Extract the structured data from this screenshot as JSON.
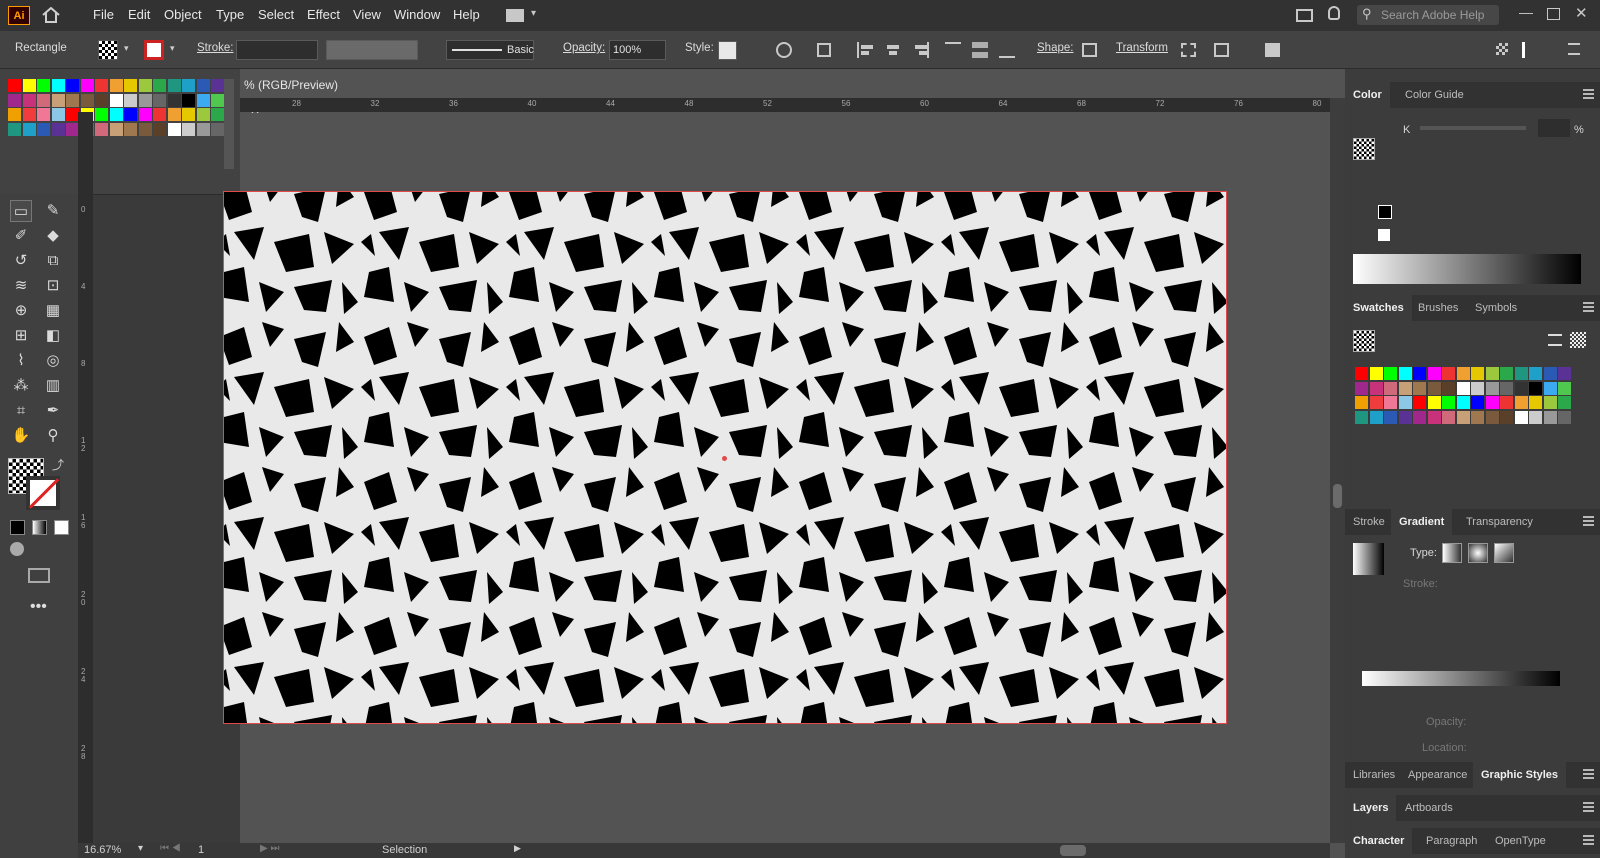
{
  "app": {
    "logo": "Ai",
    "menu": [
      "File",
      "Edit",
      "Object",
      "Type",
      "Select",
      "Effect",
      "View",
      "Window",
      "Help"
    ],
    "search_placeholder": "Search Adobe Help"
  },
  "control": {
    "tool_name": "Rectangle",
    "stroke_label": "Stroke:",
    "brush_label": "Basic",
    "opacity_label": "Opacity:",
    "opacity_value": "100%",
    "style_label": "Style:",
    "shape_label": "Shape:",
    "transform_label": "Transform"
  },
  "document": {
    "tab_title": "% (RGB/Preview)",
    "close_glyph": "✕"
  },
  "rulers": {
    "h_ticks": [
      "28",
      "32",
      "36",
      "40",
      "44",
      "48",
      "52",
      "56",
      "60",
      "64",
      "68",
      "72",
      "76",
      "80"
    ],
    "v_ticks": [
      "0",
      "4",
      "8",
      "1\n2",
      "1\n6",
      "2\n0",
      "2\n4",
      "2\n8"
    ]
  },
  "status": {
    "zoom": "16.67%",
    "page": "1",
    "tool": "Selection"
  },
  "panels": {
    "color": {
      "tabs": [
        "Color",
        "Color Guide"
      ],
      "k_label": "K",
      "percent": "%"
    },
    "swatches": {
      "tabs": [
        "Swatches",
        "Brushes",
        "Symbols"
      ]
    },
    "gradient": {
      "tabs": [
        "Stroke",
        "Gradient",
        "Transparency"
      ],
      "type_label": "Type:",
      "stroke_label": "Stroke:",
      "opacity_label": "Opacity:",
      "location_label": "Location:"
    },
    "libraries": {
      "tabs": [
        "Libraries",
        "Appearance",
        "Graphic Styles"
      ]
    },
    "layers": {
      "tabs": [
        "Layers",
        "Artboards"
      ]
    },
    "character": {
      "tabs": [
        "Character",
        "Paragraph",
        "OpenType"
      ]
    }
  },
  "colors": {
    "accent_red": "#e04a4a",
    "artboard_bg": "#e9e9e9",
    "shape_fill": "#000000",
    "chrome_dark": "#323232"
  },
  "icons": [
    "home-icon",
    "workspace-icon",
    "lightbulb-icon",
    "search-icon",
    "minimize-icon",
    "maximize-icon",
    "close-icon",
    "selection-tool-icon",
    "pen-tool-icon",
    "rectangle-tool-icon",
    "brush-tool-icon",
    "hand-tool-icon",
    "zoom-tool-icon"
  ]
}
